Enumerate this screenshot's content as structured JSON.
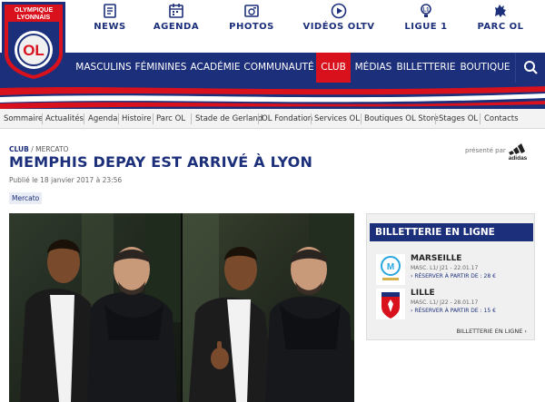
{
  "header": {
    "logo_top": "OLYMPIQUE",
    "logo_bottom": "LYONNAIS",
    "logo_mark": "OL",
    "top_links": [
      {
        "label": "NEWS",
        "icon": "news-icon"
      },
      {
        "label": "AGENDA",
        "icon": "calendar-icon"
      },
      {
        "label": "PHOTOS",
        "icon": "camera-icon"
      },
      {
        "label": "VIDÉOS OLTV",
        "icon": "play-icon"
      },
      {
        "label": "LIGUE 1",
        "icon": "ligue1-icon"
      },
      {
        "label": "PARC OL",
        "icon": "lion-icon"
      }
    ]
  },
  "nav": {
    "items": [
      "MASCULINS",
      "FÉMININES",
      "ACADÉMIE",
      "COMMUNAUTÉ",
      "CLUB",
      "MÉDIAS",
      "BILLETTERIE",
      "BOUTIQUE"
    ],
    "active": "CLUB"
  },
  "subnav": {
    "items": [
      "Sommaire",
      "Actualités",
      "Agenda",
      "Histoire",
      "Parc OL",
      "Stade de Gerland",
      "OL Fondation",
      "Services OL",
      "Boutiques OL Store",
      "Stages OL",
      "Contacts"
    ]
  },
  "article": {
    "crumb_section": "CLUB",
    "crumb_sep": "/",
    "crumb_sub": "MERCATO",
    "title": "MEMPHIS DEPAY EST ARRIVÉ À LYON",
    "published": "Publié le 18 janvier 2017 à 23:56",
    "tag": "Mercato",
    "sponsor_text": "présenté par",
    "sponsor_name": "adidas"
  },
  "ticketing": {
    "title": "BILLETTERIE EN LIGNE",
    "matches": [
      {
        "team": "MARSEILLE",
        "info": "MASC. L1/ J21 - 22.01.17",
        "buy": "RÉSERVER À PARTIR DE : 28 €"
      },
      {
        "team": "LILLE",
        "info": "MASC. L1/ J22 - 28.01.17",
        "buy": "RÉSERVER À PARTIR DE : 15 €"
      }
    ],
    "more": "BILLETTERIE EN LIGNE"
  },
  "colors": {
    "brand_blue": "#1c2f7a",
    "accent_red": "#d8111d"
  }
}
